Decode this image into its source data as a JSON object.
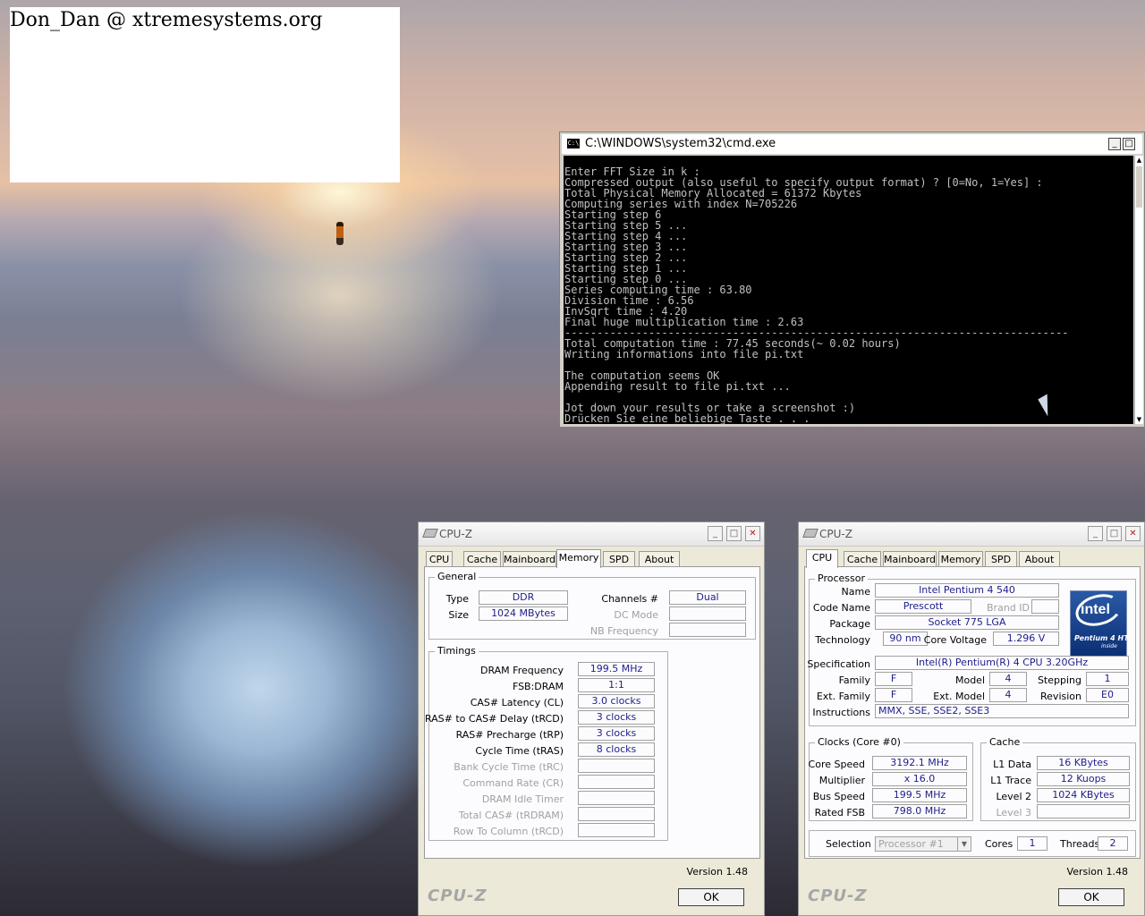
{
  "watermark": {
    "text": "Don_Dan @ xtremesystems.org"
  },
  "cmd": {
    "title": "C:\\WINDOWS\\system32\\cmd.exe",
    "icon_label": "C:\\",
    "lines": [
      "Enter FFT Size in k :",
      "Compressed output (also useful to specify output format) ? [0=No, 1=Yes] :",
      "Total Physical Memory Allocated = 61372 Kbytes",
      "Computing series with index N=705226",
      "Starting step 6",
      "Starting step 5 ...",
      "Starting step 4 ...",
      "Starting step 3 ...",
      "Starting step 2 ...",
      "Starting step 1 ...",
      "Starting step 0 ...",
      "Series computing time : 63.80",
      "Division time : 6.56",
      "InvSqrt time : 4.20",
      "Final huge multiplication time : 2.63",
      "------------------------------------------------------------------------------",
      "Total computation time : 77.45 seconds(~ 0.02 hours)",
      "Writing informations into file pi.txt",
      "",
      "The computation seems OK",
      "Appending result to file pi.txt ...",
      "",
      "Jot down your results or take a screenshot :)",
      "Drücken Sie eine beliebige Taste . . . _"
    ]
  },
  "cpuz_memory": {
    "title": "CPU-Z",
    "tabs": [
      "CPU",
      "Cache",
      "Mainboard",
      "Memory",
      "SPD",
      "About"
    ],
    "active_tab": "Memory",
    "general": {
      "title": "General",
      "type_label": "Type",
      "type": "DDR",
      "size_label": "Size",
      "size": "1024 MBytes",
      "channels_label": "Channels #",
      "channels": "Dual",
      "dc_mode_label": "DC Mode",
      "dc_mode": "",
      "nb_freq_label": "NB Frequency",
      "nb_freq": ""
    },
    "timings": {
      "title": "Timings",
      "rows": [
        {
          "label": "DRAM Frequency",
          "value": "199.5 MHz",
          "dim": false
        },
        {
          "label": "FSB:DRAM",
          "value": "1:1",
          "dim": false
        },
        {
          "label": "CAS# Latency (CL)",
          "value": "3.0 clocks",
          "dim": false
        },
        {
          "label": "RAS# to CAS# Delay (tRCD)",
          "value": "3 clocks",
          "dim": false
        },
        {
          "label": "RAS# Precharge (tRP)",
          "value": "3 clocks",
          "dim": false
        },
        {
          "label": "Cycle Time (tRAS)",
          "value": "8 clocks",
          "dim": false
        },
        {
          "label": "Bank Cycle Time (tRC)",
          "value": "",
          "dim": true
        },
        {
          "label": "Command Rate (CR)",
          "value": "",
          "dim": true
        },
        {
          "label": "DRAM Idle Timer",
          "value": "",
          "dim": true
        },
        {
          "label": "Total CAS# (tRDRAM)",
          "value": "",
          "dim": true
        },
        {
          "label": "Row To Column (tRCD)",
          "value": "",
          "dim": true
        }
      ]
    },
    "version": "Version 1.48",
    "brand": "CPU-Z",
    "ok_label": "OK"
  },
  "cpuz_cpu": {
    "title": "CPU-Z",
    "tabs": [
      "CPU",
      "Cache",
      "Mainboard",
      "Memory",
      "SPD",
      "About"
    ],
    "active_tab": "CPU",
    "processor": {
      "title": "Processor",
      "name_label": "Name",
      "name": "Intel Pentium 4 540",
      "code_name_label": "Code Name",
      "code_name": "Prescott",
      "brand_id_label": "Brand ID",
      "brand_id": "",
      "package_label": "Package",
      "package": "Socket 775 LGA",
      "technology_label": "Technology",
      "technology": "90 nm",
      "core_voltage_label": "Core Voltage",
      "core_voltage": "1.296 V",
      "spec_label": "Specification",
      "spec": "Intel(R) Pentium(R) 4 CPU 3.20GHz",
      "family_label": "Family",
      "family": "F",
      "model_label": "Model",
      "model": "4",
      "stepping_label": "Stepping",
      "stepping": "1",
      "ext_family_label": "Ext. Family",
      "ext_family": "F",
      "ext_model_label": "Ext. Model",
      "ext_model": "4",
      "revision_label": "Revision",
      "revision": "E0",
      "instructions_label": "Instructions",
      "instructions": "MMX, SSE, SSE2, SSE3"
    },
    "logo": {
      "word": "intel",
      "line": "Pentium 4 HT",
      "inside": "inside"
    },
    "clocks": {
      "title": "Clocks (Core #0)",
      "core_speed_label": "Core Speed",
      "core_speed": "3192.1 MHz",
      "multiplier_label": "Multiplier",
      "multiplier": "x 16.0",
      "bus_speed_label": "Bus Speed",
      "bus_speed": "199.5 MHz",
      "rated_fsb_label": "Rated FSB",
      "rated_fsb": "798.0 MHz"
    },
    "cache": {
      "title": "Cache",
      "l1_data_label": "L1 Data",
      "l1_data": "16 KBytes",
      "l1_trace_label": "L1 Trace",
      "l1_trace": "12 Kuops",
      "level2_label": "Level 2",
      "level2": "1024 KBytes",
      "level3_label": "Level 3",
      "level3": ""
    },
    "selection_label": "Selection",
    "selection": "Processor #1",
    "cores_label": "Cores",
    "cores": "1",
    "threads_label": "Threads",
    "threads": "2",
    "version": "Version 1.48",
    "brand": "CPU-Z",
    "ok_label": "OK"
  }
}
